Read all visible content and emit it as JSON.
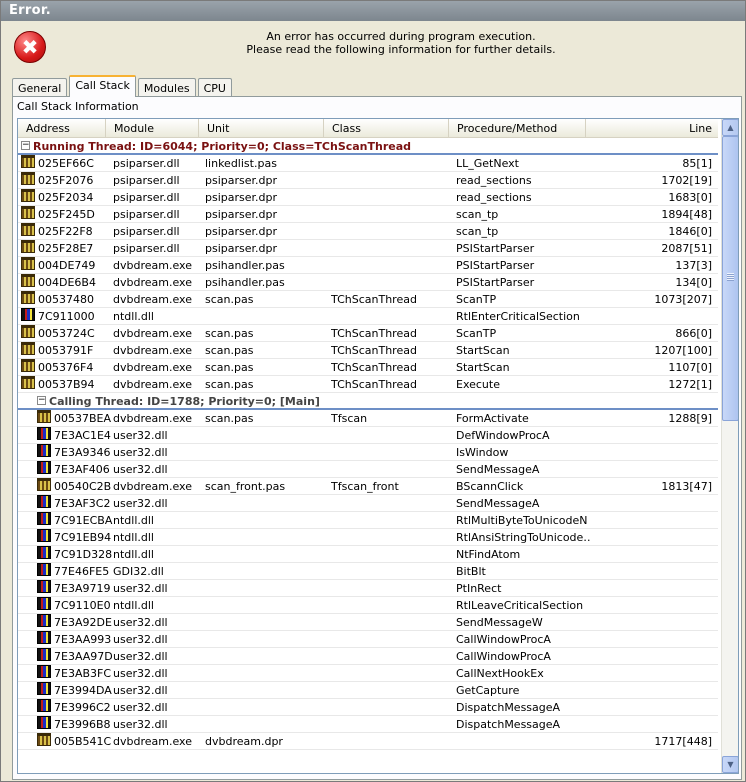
{
  "window": {
    "title": "Error."
  },
  "header": {
    "line1": "An error has occurred during program execution.",
    "line2": "Please read the following information for further details."
  },
  "tabs": [
    "General",
    "Call Stack",
    "Modules",
    "CPU"
  ],
  "active_tab": "Call Stack",
  "panel_title": "Call Stack Information",
  "columns": [
    "Address",
    "Module",
    "Unit",
    "Class",
    "Procedure/Method",
    "Line"
  ],
  "running_thread": {
    "label": "Running Thread: ID=6044; Priority=0; Class=TChScanThread",
    "rows": [
      {
        "icon": "unit-icon",
        "address": "025EF66C",
        "module": "psiparser.dll",
        "unit": "linkedlist.pas",
        "class": "",
        "proc": "LL_GetNext",
        "line": "85[1]"
      },
      {
        "icon": "unit-icon",
        "address": "025F2076",
        "module": "psiparser.dll",
        "unit": "psiparser.dpr",
        "class": "",
        "proc": "read_sections",
        "line": "1702[19]"
      },
      {
        "icon": "unit-icon",
        "address": "025F2034",
        "module": "psiparser.dll",
        "unit": "psiparser.dpr",
        "class": "",
        "proc": "read_sections",
        "line": "1683[0]"
      },
      {
        "icon": "unit-icon",
        "address": "025F245D",
        "module": "psiparser.dll",
        "unit": "psiparser.dpr",
        "class": "",
        "proc": "scan_tp",
        "line": "1894[48]"
      },
      {
        "icon": "unit-icon",
        "address": "025F22F8",
        "module": "psiparser.dll",
        "unit": "psiparser.dpr",
        "class": "",
        "proc": "scan_tp",
        "line": "1846[0]"
      },
      {
        "icon": "unit-icon",
        "address": "025F28E7",
        "module": "psiparser.dll",
        "unit": "psiparser.dpr",
        "class": "",
        "proc": "PSIStartParser",
        "line": "2087[51]"
      },
      {
        "icon": "unit-icon",
        "address": "004DE749",
        "module": "dvbdream.exe",
        "unit": "psihandler.pas",
        "class": "",
        "proc": "PSIStartParser",
        "line": "137[3]"
      },
      {
        "icon": "unit-icon",
        "address": "004DE6B4",
        "module": "dvbdream.exe",
        "unit": "psihandler.pas",
        "class": "",
        "proc": "PSIStartParser",
        "line": "134[0]"
      },
      {
        "icon": "unit-icon",
        "address": "00537480",
        "module": "dvbdream.exe",
        "unit": "scan.pas",
        "class": "TChScanThread",
        "proc": "ScanTP",
        "line": "1073[207]"
      },
      {
        "icon": "system-icon",
        "address": "7C911000",
        "module": "ntdll.dll",
        "unit": "",
        "class": "",
        "proc": "RtlEnterCriticalSection",
        "line": ""
      },
      {
        "icon": "unit-icon",
        "address": "0053724C",
        "module": "dvbdream.exe",
        "unit": "scan.pas",
        "class": "TChScanThread",
        "proc": "ScanTP",
        "line": "866[0]"
      },
      {
        "icon": "unit-icon",
        "address": "0053791F",
        "module": "dvbdream.exe",
        "unit": "scan.pas",
        "class": "TChScanThread",
        "proc": "StartScan",
        "line": "1207[100]"
      },
      {
        "icon": "unit-icon",
        "address": "005376F4",
        "module": "dvbdream.exe",
        "unit": "scan.pas",
        "class": "TChScanThread",
        "proc": "StartScan",
        "line": "1107[0]"
      },
      {
        "icon": "unit-icon",
        "address": "00537B94",
        "module": "dvbdream.exe",
        "unit": "scan.pas",
        "class": "TChScanThread",
        "proc": "Execute",
        "line": "1272[1]"
      }
    ]
  },
  "calling_thread": {
    "label": "Calling Thread: ID=1788; Priority=0; [Main]",
    "rows": [
      {
        "icon": "unit-icon",
        "address": "00537BEA",
        "module": "dvbdream.exe",
        "unit": "scan.pas",
        "class": "Tfscan",
        "proc": "FormActivate",
        "line": "1288[9]"
      },
      {
        "icon": "system-icon",
        "address": "7E3AC1E4",
        "module": "user32.dll",
        "unit": "",
        "class": "",
        "proc": "DefWindowProcA",
        "line": ""
      },
      {
        "icon": "system-icon",
        "address": "7E3A9346",
        "module": "user32.dll",
        "unit": "",
        "class": "",
        "proc": "IsWindow",
        "line": ""
      },
      {
        "icon": "system-icon",
        "address": "7E3AF406",
        "module": "user32.dll",
        "unit": "",
        "class": "",
        "proc": "SendMessageA",
        "line": ""
      },
      {
        "icon": "unit-icon",
        "address": "00540C2B",
        "module": "dvbdream.exe",
        "unit": "scan_front.pas",
        "class": "Tfscan_front",
        "proc": "BScannClick",
        "line": "1813[47]"
      },
      {
        "icon": "system-icon",
        "address": "7E3AF3C2",
        "module": "user32.dll",
        "unit": "",
        "class": "",
        "proc": "SendMessageA",
        "line": ""
      },
      {
        "icon": "system-icon",
        "address": "7C91ECBA",
        "module": "ntdll.dll",
        "unit": "",
        "class": "",
        "proc": "RtlMultiByteToUnicodeN",
        "line": ""
      },
      {
        "icon": "system-icon",
        "address": "7C91EB94",
        "module": "ntdll.dll",
        "unit": "",
        "class": "",
        "proc": "RtlAnsiStringToUnicode…",
        "line": ""
      },
      {
        "icon": "system-icon",
        "address": "7C91D328",
        "module": "ntdll.dll",
        "unit": "",
        "class": "",
        "proc": "NtFindAtom",
        "line": ""
      },
      {
        "icon": "system-icon",
        "address": "77E46FE5",
        "module": "GDI32.dll",
        "unit": "",
        "class": "",
        "proc": "BitBlt",
        "line": ""
      },
      {
        "icon": "system-icon",
        "address": "7E3A9719",
        "module": "user32.dll",
        "unit": "",
        "class": "",
        "proc": "PtInRect",
        "line": ""
      },
      {
        "icon": "system-icon",
        "address": "7C9110E0",
        "module": "ntdll.dll",
        "unit": "",
        "class": "",
        "proc": "RtlLeaveCriticalSection",
        "line": ""
      },
      {
        "icon": "system-icon",
        "address": "7E3A92DE",
        "module": "user32.dll",
        "unit": "",
        "class": "",
        "proc": "SendMessageW",
        "line": ""
      },
      {
        "icon": "system-icon",
        "address": "7E3AA993",
        "module": "user32.dll",
        "unit": "",
        "class": "",
        "proc": "CallWindowProcA",
        "line": ""
      },
      {
        "icon": "system-icon",
        "address": "7E3AA97D",
        "module": "user32.dll",
        "unit": "",
        "class": "",
        "proc": "CallWindowProcA",
        "line": ""
      },
      {
        "icon": "system-icon",
        "address": "7E3AB3FC",
        "module": "user32.dll",
        "unit": "",
        "class": "",
        "proc": "CallNextHookEx",
        "line": ""
      },
      {
        "icon": "system-icon",
        "address": "7E3994DA",
        "module": "user32.dll",
        "unit": "",
        "class": "",
        "proc": "GetCapture",
        "line": ""
      },
      {
        "icon": "system-icon",
        "address": "7E3996C2",
        "module": "user32.dll",
        "unit": "",
        "class": "",
        "proc": "DispatchMessageA",
        "line": ""
      },
      {
        "icon": "system-icon",
        "address": "7E3996B8",
        "module": "user32.dll",
        "unit": "",
        "class": "",
        "proc": "DispatchMessageA",
        "line": ""
      },
      {
        "icon": "unit-icon",
        "address": "005B541C",
        "module": "dvbdream.exe",
        "unit": "dvbdream.dpr",
        "class": "",
        "proc": "",
        "line": "1717[448]"
      }
    ]
  },
  "expand_glyph": "−",
  "scroll": {
    "up_icon": "scroll-up-icon",
    "down_icon": "scroll-down-icon",
    "up_glyph": "▲",
    "down_glyph": "▼"
  },
  "error_icon": {
    "icon": "error-icon",
    "glyph": "✖",
    "color": "#d71a1a"
  },
  "colors": {
    "running_thread": "#7a1111",
    "active_tab_accent": "#f7b233"
  }
}
